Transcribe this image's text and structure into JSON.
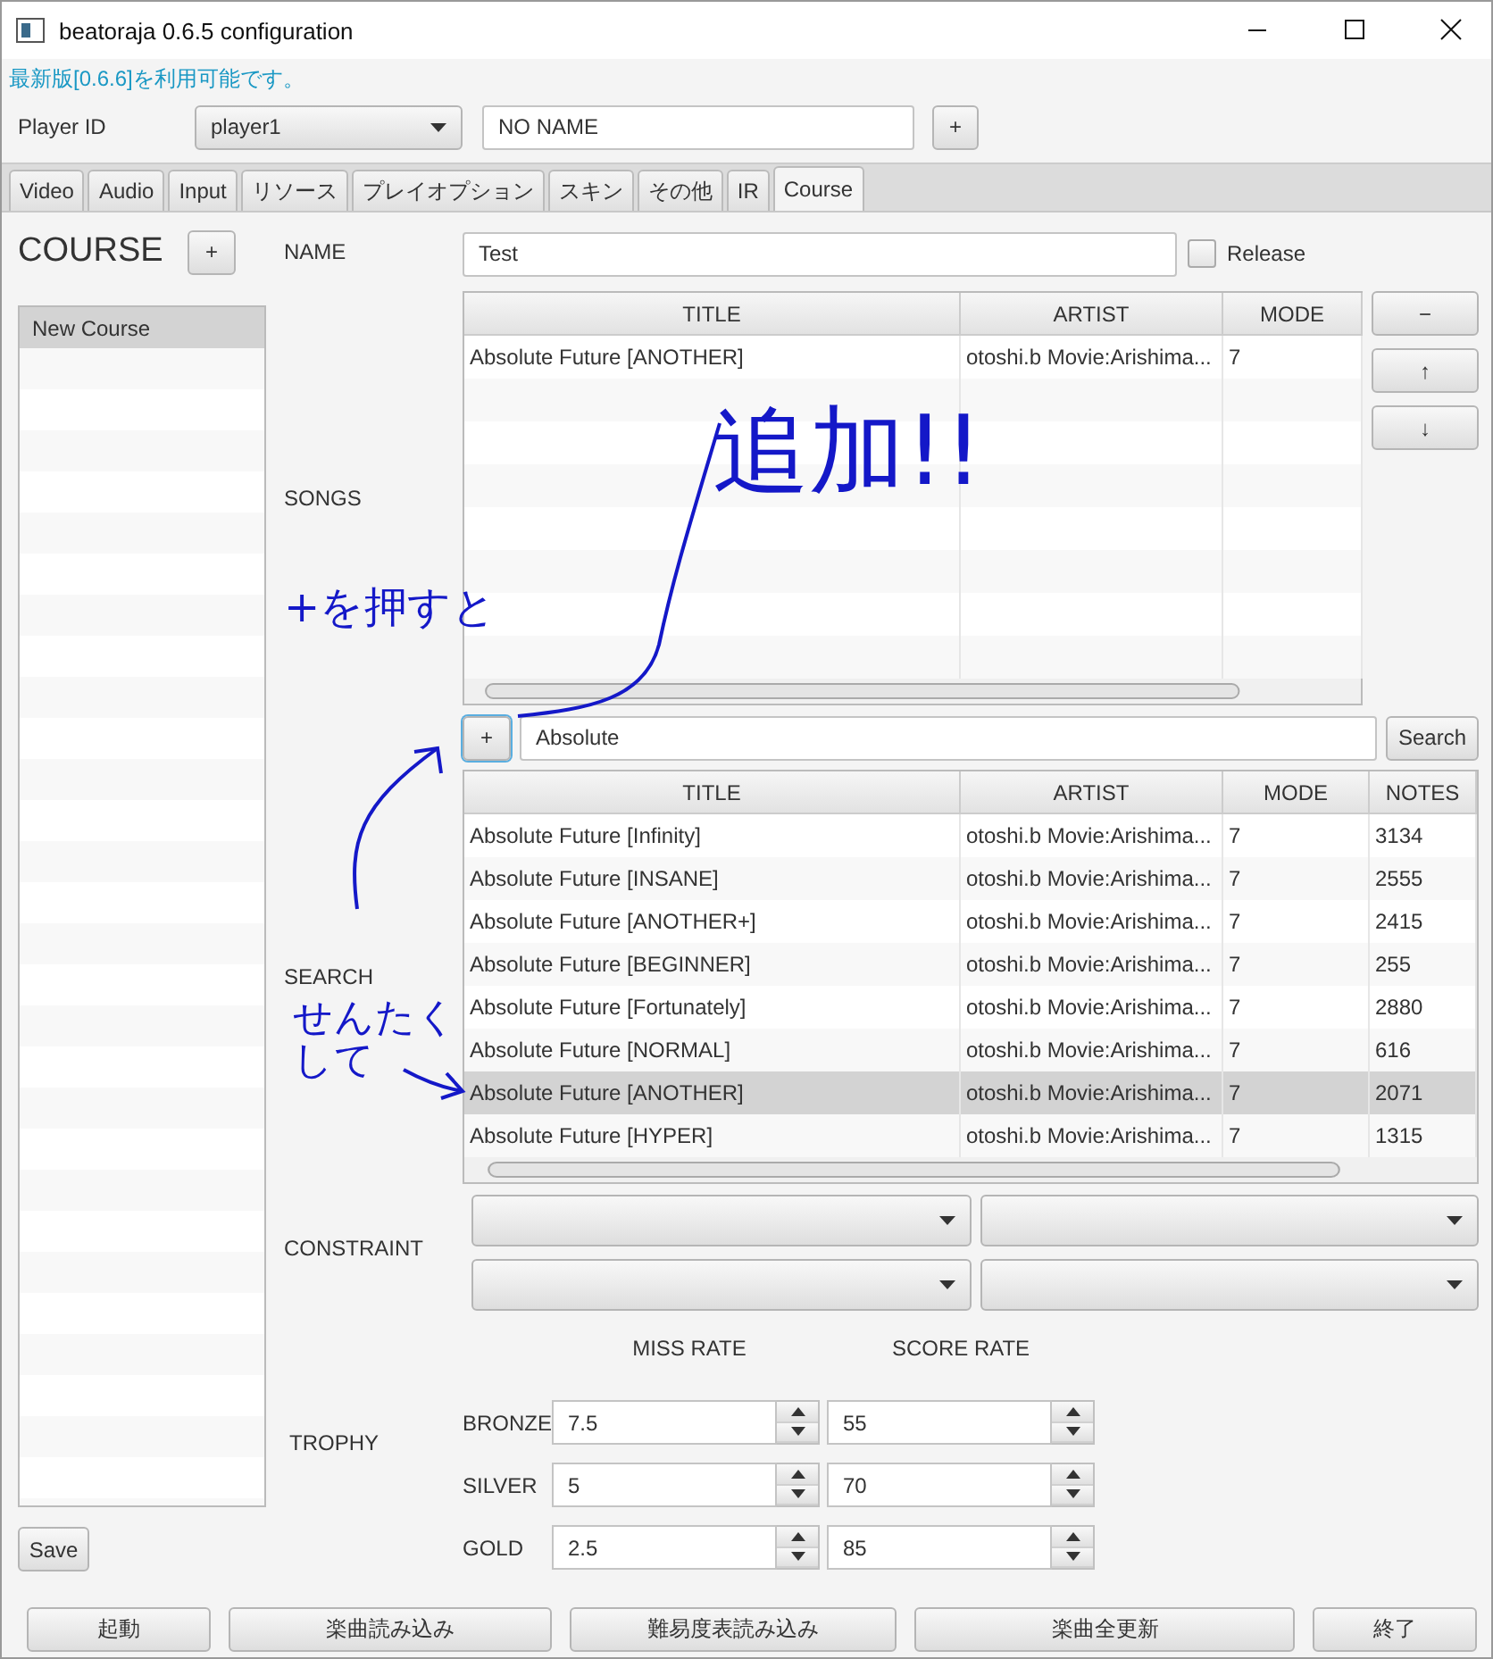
{
  "window": {
    "title": "beatoraja 0.6.5 configuration"
  },
  "update_notice": "最新版[0.6.6]を利用可能です。",
  "player": {
    "label": "Player ID",
    "id_select": "player1",
    "name_value": "NO NAME",
    "add_button": "+"
  },
  "tabs": [
    {
      "label": "Video",
      "selected": false
    },
    {
      "label": "Audio",
      "selected": false
    },
    {
      "label": "Input",
      "selected": false
    },
    {
      "label": "リソース",
      "selected": false
    },
    {
      "label": "プレイオプション",
      "selected": false
    },
    {
      "label": "スキン",
      "selected": false
    },
    {
      "label": "その他",
      "selected": false
    },
    {
      "label": "IR",
      "selected": false
    },
    {
      "label": "Course",
      "selected": true
    }
  ],
  "course": {
    "heading": "COURSE",
    "add_button": "+",
    "items": [
      {
        "label": "New Course",
        "selected": true
      }
    ],
    "save_button": "Save"
  },
  "name": {
    "label": "NAME",
    "value": "Test"
  },
  "release": {
    "label": "Release",
    "checked": false
  },
  "songs": {
    "label": "SONGS",
    "columns": [
      "TITLE",
      "ARTIST",
      "MODE"
    ],
    "rows": [
      {
        "cells": [
          "Absolute Future [ANOTHER]",
          "otoshi.b Movie:Arishima...",
          "7"
        ],
        "selected": false
      }
    ],
    "buttons": [
      "−",
      "↑",
      "↓"
    ]
  },
  "search": {
    "label": "SEARCH",
    "add_button": "+",
    "query": "Absolute",
    "button": "Search",
    "columns": [
      "TITLE",
      "ARTIST",
      "MODE",
      "NOTES"
    ],
    "rows": [
      {
        "cells": [
          "Absolute Future [Infinity]",
          "otoshi.b Movie:Arishima...",
          "7",
          "3134"
        ],
        "selected": false
      },
      {
        "cells": [
          "Absolute Future [INSANE]",
          "otoshi.b Movie:Arishima...",
          "7",
          "2555"
        ],
        "selected": false
      },
      {
        "cells": [
          "Absolute Future [ANOTHER+]",
          "otoshi.b Movie:Arishima...",
          "7",
          "2415"
        ],
        "selected": false
      },
      {
        "cells": [
          "Absolute Future [BEGINNER]",
          "otoshi.b Movie:Arishima...",
          "7",
          "255"
        ],
        "selected": false
      },
      {
        "cells": [
          "Absolute Future [Fortunately]",
          "otoshi.b Movie:Arishima...",
          "7",
          "2880"
        ],
        "selected": false
      },
      {
        "cells": [
          "Absolute Future [NORMAL]",
          "otoshi.b Movie:Arishima...",
          "7",
          "616"
        ],
        "selected": false
      },
      {
        "cells": [
          "Absolute Future [ANOTHER]",
          "otoshi.b Movie:Arishima...",
          "7",
          "2071"
        ],
        "selected": true
      },
      {
        "cells": [
          "Absolute Future [HYPER]",
          "otoshi.b Movie:Arishima...",
          "7",
          "1315"
        ],
        "selected": false
      }
    ]
  },
  "constraint": {
    "label": "CONSTRAINT",
    "selects": [
      {
        "kind": "dropdown"
      },
      {
        "kind": "dropdown"
      },
      {
        "kind": "dropdown"
      },
      {
        "kind": "dropdown"
      }
    ]
  },
  "trophy": {
    "label": "TROPHY",
    "headers": [
      "MISS RATE",
      "SCORE RATE"
    ],
    "rows": [
      {
        "label": "BRONZE",
        "miss_rate": "7.5",
        "score_rate": "55"
      },
      {
        "label": "SILVER",
        "miss_rate": "5",
        "score_rate": "70"
      },
      {
        "label": "GOLD",
        "miss_rate": "2.5",
        "score_rate": "85"
      }
    ]
  },
  "footer_buttons": [
    "起動",
    "楽曲読み込み",
    "難易度表読み込み",
    "楽曲全更新",
    "終了"
  ],
  "annotations": [
    {
      "kind": "text",
      "text": "追加!!"
    },
    {
      "kind": "text",
      "text": "+を押すと"
    },
    {
      "kind": "text",
      "text": "せんたくして"
    },
    {
      "kind": "line"
    },
    {
      "kind": "arrow"
    },
    {
      "kind": "arrow"
    }
  ]
}
